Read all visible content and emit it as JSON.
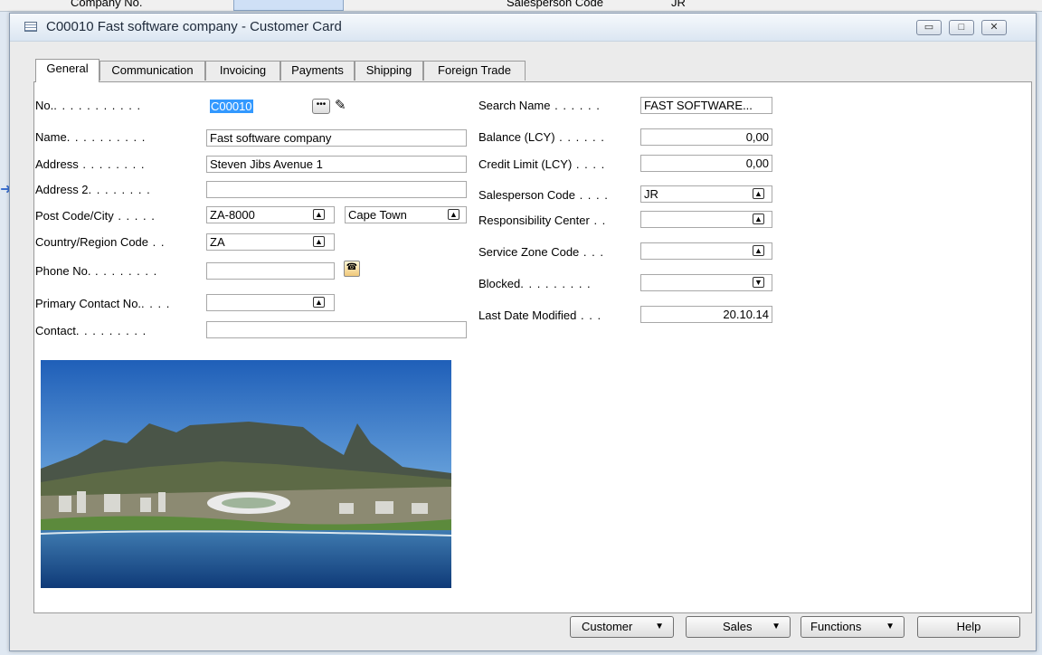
{
  "background": {
    "text_left": "Company No.",
    "text_right": "Salesperson Code",
    "value_right": "JR"
  },
  "window": {
    "title": "C00010 Fast software company - Customer Card",
    "controls": {
      "minimize": "▭",
      "maximize": "□",
      "close": "✕"
    }
  },
  "tabs": [
    "General",
    "Communication",
    "Invoicing",
    "Payments",
    "Shipping",
    "Foreign Trade"
  ],
  "left_fields": {
    "no": {
      "label": "No.",
      "value": "C00010"
    },
    "name": {
      "label": "Name",
      "value": "Fast software company"
    },
    "address": {
      "label": "Address",
      "value": "Steven Jibs Avenue 1"
    },
    "address2": {
      "label": "Address 2",
      "value": ""
    },
    "post_code_city": {
      "label": "Post Code/City",
      "post_code": "ZA-8000",
      "city": "Cape Town"
    },
    "country": {
      "label": "Country/Region Code",
      "value": "ZA"
    },
    "phone": {
      "label": "Phone No.",
      "value": ""
    },
    "primary_contact": {
      "label": "Primary Contact No.",
      "value": ""
    },
    "contact": {
      "label": "Contact",
      "value": ""
    }
  },
  "right_fields": {
    "search_name": {
      "label": "Search Name",
      "value": "FAST SOFTWARE..."
    },
    "balance": {
      "label": "Balance (LCY)",
      "value": "0,00"
    },
    "credit_limit": {
      "label": "Credit Limit (LCY)",
      "value": "0,00"
    },
    "salesperson": {
      "label": "Salesperson Code",
      "value": "JR"
    },
    "responsibility": {
      "label": "Responsibility Center",
      "value": ""
    },
    "service_zone": {
      "label": "Service Zone Code",
      "value": ""
    },
    "blocked": {
      "label": "Blocked",
      "value": ""
    },
    "last_modified": {
      "label": "Last Date Modified",
      "value": "20.10.14"
    }
  },
  "buttons": {
    "customer": "Customer",
    "sales": "Sales",
    "functions": "Functions",
    "help": "Help"
  },
  "icons": {
    "lookup": "up-arrow-lookup-icon",
    "dropdown": "dropdown-icon",
    "assist": "ellipsis-icon",
    "edit": "pencil-icon",
    "phone": "phone-dial-icon"
  }
}
